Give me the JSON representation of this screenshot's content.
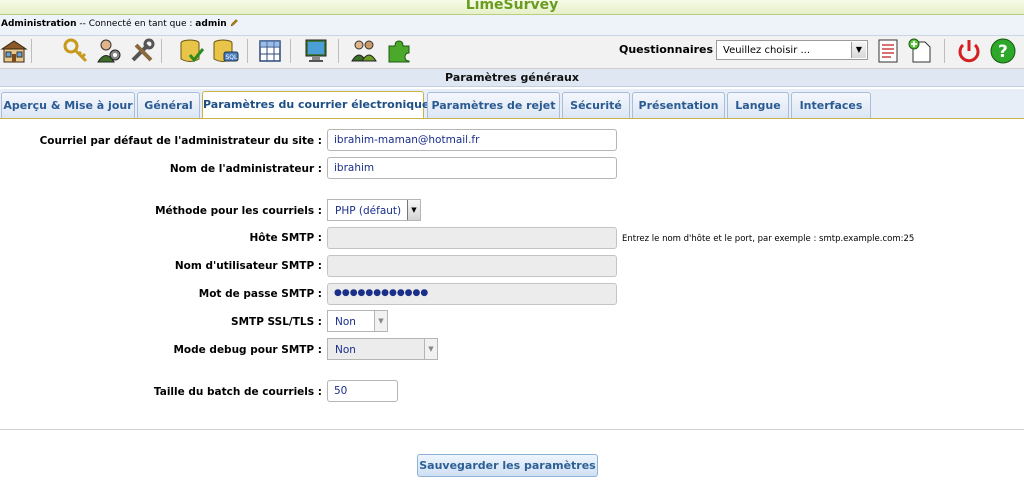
{
  "app": {
    "title": "LimeSurvey"
  },
  "admin_bar": {
    "admin": "Administration",
    "connected_text": " -- Connecté en tant que : ",
    "username": "admin"
  },
  "toolbar": {
    "icons": [
      "home-icon",
      "keys-icon",
      "user-admin-icon",
      "tools-icon",
      "check-db-icon",
      "sql-backup-icon",
      "label-sets-icon",
      "templates-icon",
      "participants-icon",
      "plugins-icon",
      "survey-list-icon",
      "new-survey-icon",
      "logout-icon",
      "help-icon"
    ],
    "survey_label": "Questionnaires :",
    "survey_select": "Veuillez choisir ..."
  },
  "section_title": "Paramètres généraux",
  "tabs": [
    {
      "label": "Aperçu & Mise à jour"
    },
    {
      "label": "Général"
    },
    {
      "label": "Paramètres du courrier électronique"
    },
    {
      "label": "Paramètres de rejet"
    },
    {
      "label": "Sécurité"
    },
    {
      "label": "Présentation"
    },
    {
      "label": "Langue"
    },
    {
      "label": "Interfaces"
    }
  ],
  "active_tab": "Paramètres du courrier électronique",
  "form": {
    "site_admin_email": {
      "label": "Courriel par défaut de l'administrateur du site :",
      "value": "ibrahim-maman@hotmail.fr"
    },
    "admin_name": {
      "label": "Nom de l'administrateur :",
      "value": "ibrahim"
    },
    "email_method": {
      "label": "Méthode pour les courriels :",
      "value": "PHP (défaut)"
    },
    "smtp_host": {
      "label": "Hôte SMTP :",
      "value": "",
      "hint": "Entrez le nom d'hôte et le port, par exemple : smtp.example.com:25"
    },
    "smtp_user": {
      "label": "Nom d'utilisateur SMTP :",
      "value": ""
    },
    "smtp_password": {
      "label": "Mot de passe SMTP :",
      "value": "●●●●●●●●●●●●"
    },
    "smtp_ssl": {
      "label": "SMTP SSL/TLS :",
      "value": "Non"
    },
    "smtp_debug": {
      "label": "Mode debug pour SMTP :",
      "value": "Non"
    },
    "batch_size": {
      "label": "Taille du batch de courriels :",
      "value": "50"
    }
  },
  "save_button": "Sauvegarder les paramètres",
  "colors": {
    "accent": "#6a9c22",
    "tab_text": "#2a5a92",
    "input_text": "#1a2f8a"
  }
}
